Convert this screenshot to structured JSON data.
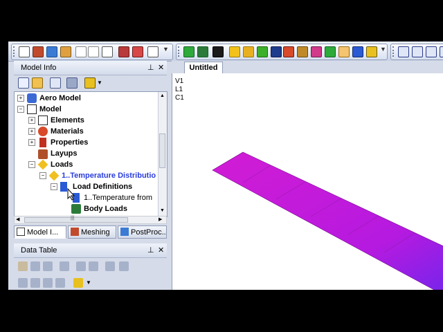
{
  "toolbar": {
    "more_glyph": "▼"
  },
  "model_info_panel": {
    "title": "Model Info",
    "pin_glyph": "📌",
    "close_glyph": "✕",
    "tree": [
      {
        "label": "Aero Model",
        "icon": "aero-icon",
        "expander": "+"
      },
      {
        "label": "Model",
        "icon": "grid-icon",
        "expander": "−"
      },
      {
        "label": "Elements",
        "icon": "elements-icon",
        "expander": "+"
      },
      {
        "label": "Materials",
        "icon": "materials-icon",
        "expander": "+"
      },
      {
        "label": "Properties",
        "icon": "properties-icon",
        "expander": "+"
      },
      {
        "label": "Layups",
        "icon": "layups-icon",
        "expander": ""
      },
      {
        "label": "Loads",
        "icon": "loads-icon",
        "expander": "−"
      },
      {
        "label": "1..Temperature Distributio",
        "icon": "load-set-icon",
        "expander": "−"
      },
      {
        "label": "Load Definitions",
        "icon": "load-definitions-icon",
        "expander": "−"
      },
      {
        "label": "1..Temperature from",
        "icon": "temperature-load-icon",
        "expander": ""
      },
      {
        "label": "Body Loads",
        "icon": "body-loads-icon",
        "expander": ""
      }
    ],
    "hscroll_grip": "|||",
    "tabs": [
      {
        "label": "Model I...",
        "active": true
      },
      {
        "label": "Meshing",
        "active": false
      },
      {
        "label": "PostProc...",
        "active": false
      }
    ]
  },
  "data_table_panel": {
    "title": "Data Table",
    "pin_glyph": "📌",
    "close_glyph": "✕"
  },
  "viewport": {
    "tab_label": "Untitled",
    "view_labels": [
      "V1",
      "L1",
      "C1"
    ],
    "colors": {
      "plate_magenta": "#c81ad8",
      "plate_purple": "#8a20e8",
      "plate_edge": "#7a0a90"
    }
  }
}
